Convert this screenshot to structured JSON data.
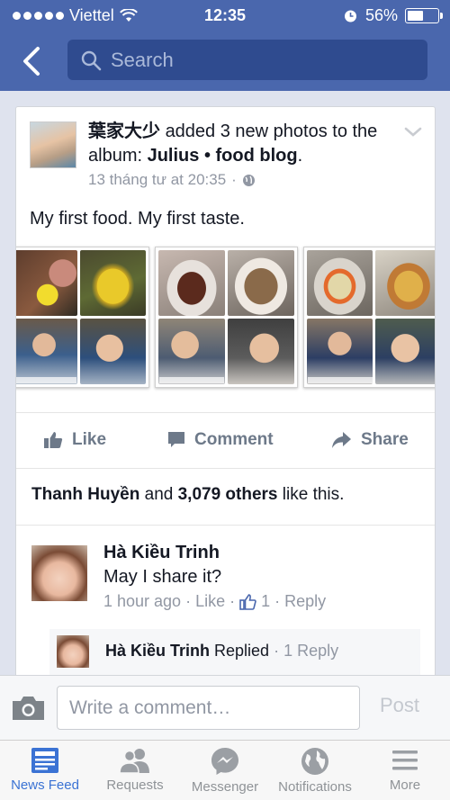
{
  "status_bar": {
    "carrier": "Viettel",
    "time": "12:35",
    "battery": "56%",
    "battery_level": 0.56
  },
  "header": {
    "search_placeholder": "Search"
  },
  "post": {
    "author": "葉家大少",
    "action_text": "added 3 new photos to the album:",
    "album": "Julius • food blog",
    "album_suffix": ".",
    "timestamp": "13 tháng tư at 20:35",
    "separator": "·",
    "caption": "My first food. My first taste.",
    "like_label": "Like",
    "comment_label": "Comment",
    "share_label": "Share",
    "likes": {
      "name": "Thanh Huyền",
      "middle": " and ",
      "count": "3,079 others",
      "suffix": " like this."
    }
  },
  "comment": {
    "name": "Hà Kiều Trinh",
    "text": "May I share it?",
    "time": "1 hour ago",
    "like_label": "Like",
    "like_count": "1",
    "reply_label": "Reply",
    "sep": "·"
  },
  "reply_preview": {
    "name": "Hà Kiều Trinh",
    "action": " Replied",
    "count": "1 Reply",
    "sep": " · "
  },
  "composer": {
    "placeholder": "Write a comment…",
    "post_label": "Post"
  },
  "tabbar": {
    "tabs": [
      {
        "label": "News Feed",
        "icon": "news-feed-icon",
        "active": true
      },
      {
        "label": "Requests",
        "icon": "requests-icon",
        "active": false
      },
      {
        "label": "Messenger",
        "icon": "messenger-icon",
        "active": false
      },
      {
        "label": "Notifications",
        "icon": "globe-icon",
        "active": false
      },
      {
        "label": "More",
        "icon": "menu-icon",
        "active": false
      }
    ]
  },
  "colors": {
    "brand": "#4a67ad",
    "search_bg": "#2f4b8f",
    "active_tab": "#3b73d4",
    "muted": "#9197a3"
  }
}
